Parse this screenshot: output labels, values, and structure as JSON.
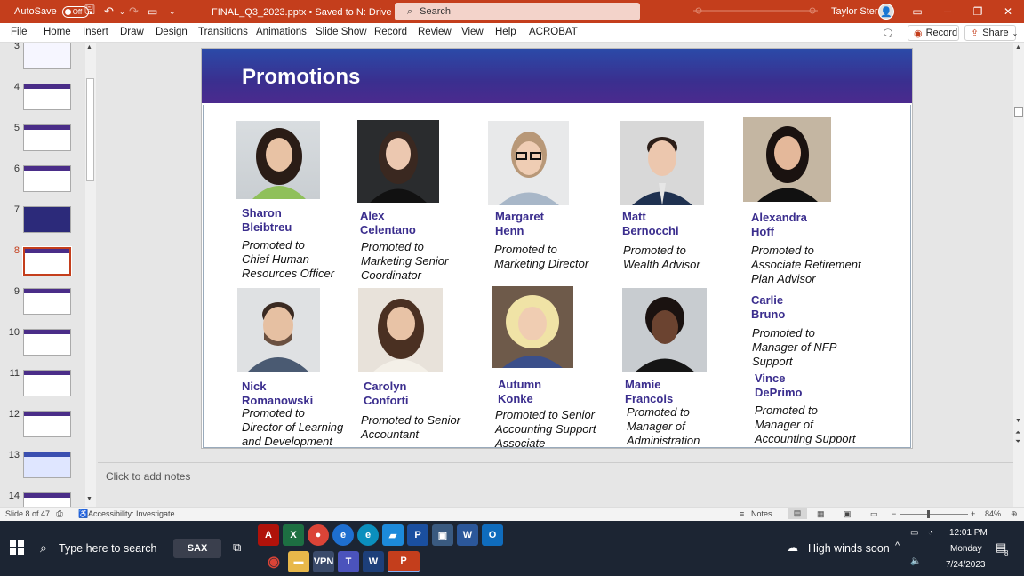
{
  "titlebar": {
    "autosave": "AutoSave",
    "autosave_state": "Off",
    "filename": "FINAL_Q3_2023.pptx • Saved to N: Drive ⌄",
    "search_placeholder": "Search",
    "user": "Taylor Stern"
  },
  "menu": [
    "File",
    "Home",
    "Insert",
    "Draw",
    "Design",
    "Transitions",
    "Animations",
    "Slide Show",
    "Record",
    "Review",
    "View",
    "Help",
    "ACROBAT"
  ],
  "ribbon": {
    "record": "Record",
    "share": "Share"
  },
  "thumbnails": [
    {
      "n": "3"
    },
    {
      "n": "4"
    },
    {
      "n": "5"
    },
    {
      "n": "6"
    },
    {
      "n": "7"
    },
    {
      "n": "8"
    },
    {
      "n": "9"
    },
    {
      "n": "10"
    },
    {
      "n": "11"
    },
    {
      "n": "12"
    },
    {
      "n": "13"
    },
    {
      "n": "14"
    }
  ],
  "slide": {
    "title": "Promotions",
    "people": [
      {
        "name": "Sharon\nBleibtreu",
        "role": "Promoted to\nChief Human\nResources Officer"
      },
      {
        "name": "Alex\nCelentano",
        "role": "Promoted to\nMarketing Senior\nCoordinator"
      },
      {
        "name": "Margaret\nHenn",
        "role": "Promoted to\nMarketing Director"
      },
      {
        "name": "Matt\nBernocchi",
        "role": "Promoted to\nWealth Advisor"
      },
      {
        "name": "Alexandra\nHoff",
        "role": "Promoted to\nAssociate Retirement\nPlan Advisor"
      },
      {
        "name": "Nick\nRomanowski",
        "role": "Promoted to\nDirector of Learning\nand Development"
      },
      {
        "name": "Carolyn\nConforti",
        "role": "Promoted to Senior\nAccountant"
      },
      {
        "name": "Autumn\nKonke",
        "role": "Promoted to Senior\nAccounting Support\nAssociate"
      },
      {
        "name": "Mamie\nFrancois",
        "role": "Promoted to\nManager of\nAdministration"
      },
      {
        "name": "Carlie\nBruno",
        "role": "Promoted to\nManager of NFP\nSupport"
      },
      {
        "name": "Vince\nDePrimo",
        "role": "Promoted to\nManager of\nAccounting Support"
      }
    ]
  },
  "notes_placeholder": "Click to add notes",
  "status": {
    "slide_counter": "Slide 8 of 47",
    "accessibility": "Accessibility: Investigate",
    "notes": "Notes",
    "zoom": "84%"
  },
  "taskbar": {
    "search_placeholder": "Type here to search",
    "sax": "SAX",
    "weather": "High winds soon",
    "time": "12:01 PM",
    "day": "Monday",
    "date": "7/24/2023",
    "notif_count": "8"
  },
  "colors": {
    "accent": "#c43e1c",
    "title_band": "#3a2f8f",
    "name_text": "#3b2e8e"
  }
}
